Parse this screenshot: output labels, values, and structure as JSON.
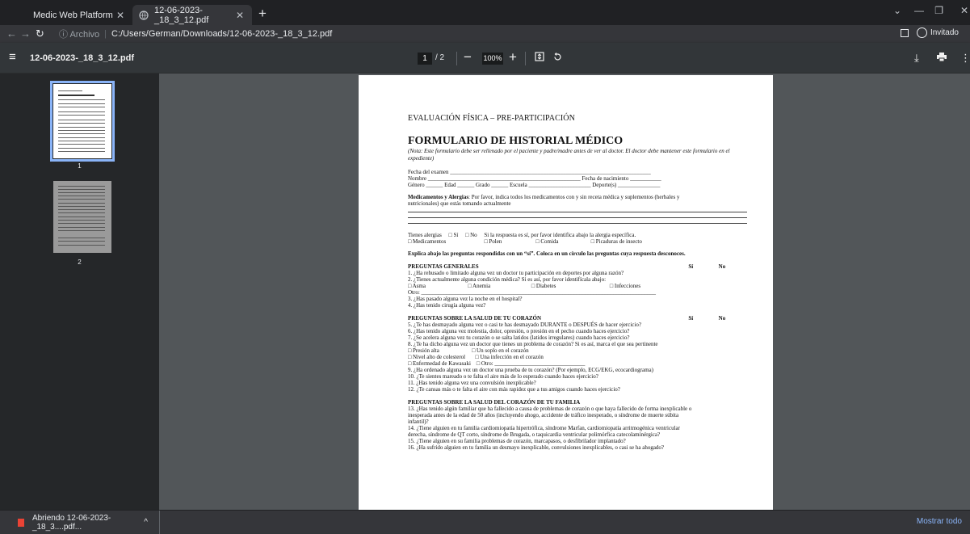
{
  "browser": {
    "tabs": [
      {
        "title": "Medic Web Platform",
        "close": "✕"
      },
      {
        "title": "12-06-2023-_18_3_12.pdf",
        "close": "✕"
      }
    ],
    "new_tab": "+",
    "address": {
      "info": "ⓘ Archivo",
      "url": "C:/Users/German/Downloads/12-06-2023-_18_3_12.pdf"
    },
    "profile": "Invitado"
  },
  "pdf_toolbar": {
    "filename": "12-06-2023-_18_3_12.pdf",
    "current_page": "1",
    "total_pages": "/ 2",
    "zoom": "100%",
    "zoom_out": "−",
    "zoom_in": "+"
  },
  "thumbnails": [
    {
      "label": "1",
      "selected": true
    },
    {
      "label": "2",
      "selected": false
    }
  ],
  "document": {
    "pre_title": "EVALUACIÓN FÍSICA – PRE-PARTICIPACIÓN",
    "title": "FORMULARIO DE HISTORIAL MÉDICO",
    "note": "(Nota: Este formulario debe ser rellenado por el paciente y padre/madre antes de ver al doctor. El doctor debe mantener este formulario en el expediente)",
    "fields": [
      "Fecha del examen _______________________________________________________________________",
      "Nombre ______________________________________________________ Fecha de nacimiento ___________",
      "Género ______ Edad ______ Grado ______ Escuela ______________________ Deporte(s) _______________"
    ],
    "meds_label": "Medicamentos y Alergias",
    "meds_text": ": Por favor, indica todos los medicamentos con y sin receta médica y suplementos (herbales y",
    "meds_text2": "nutricionales) que estás tomando actualmente",
    "allergies_line1": "Tienes alergias     □ Sí     □ No     Si la respuesta es sí, por favor identifica abajo la alergia específica.",
    "allergies_line2": "□ Medicamentos                           □ Polen                        □ Comida                       □ Picaduras de insecto",
    "explain": "Explica abajo las preguntas respondidas con un “sí”. Coloca en un círculo las preguntas cuya respuesta desconoces.",
    "yes": "Sí",
    "no": "No",
    "general_header": "PREGUNTAS GENERALES",
    "general": [
      "1. ¿Ha rehusado o limitado alguna vez un doctor tu participación en deportes por alguna razón?",
      "2. ¿Tienes actualmente alguna condición médica? Si es así, por favor identifícala abajo:",
      "□ Asma                              □ Anemia                             □ Diabetes                                      □ Infecciones",
      "Otro: ___________________________________________________________________________________",
      "3. ¿Has pasado alguna vez la noche en el hospital?",
      "4. ¿Has tenido cirugía alguna vez?"
    ],
    "heart_header": "PREGUNTAS SOBRE LA SALUD DE TU CORAZÓN",
    "heart": [
      "5. ¿Te has desmayado alguna vez o casi te has desmayado DURANTE o DESPUÉS de hacer ejercicio?",
      "6. ¿Has tenido alguna vez molestia, dolor, opresión, o presión en el pecho cuando haces ejercicio?",
      "7. ¿Se acelera alguna vez tu corazón o se salta latidos (latidos irregulares) cuando haces ejercicio?",
      "8. ¿Te ha dicho alguna vez un doctor que tienes un problema de corazón? Si es así, marca el que sea pertinente",
      "□ Presión alta                       □ Un soplo en el corazón",
      "□ Nivel alto de colesterol       □ Una infección en el corazón",
      "□ Enfermedad de Kawasaki    □ Otro: ________________________________",
      "9. ¿Ha ordenado alguna vez un doctor una prueba de tu corazón? (Por ejemplo, ECG/EKG, ecocardiograma)",
      "10. ¿Te sientes mareado o te falta el aire más de lo esperado cuando haces ejercicio?",
      "11. ¿Has tenido alguna vez una convulsión inexplicable?",
      "12. ¿Te cansas más o te falta el aire con más rapidez que a tus amigos cuando haces ejercicio?"
    ],
    "family_header": "PREGUNTAS SOBRE LA SALUD DEL CORAZÓN DE TU FAMILIA",
    "family": [
      "13. ¿Has tenido algún familiar que ha fallecido a causa de problemas de corazón o que haya fallecido de forma inexplicable o",
      "inesperada antes de la edad de 50 años (incluyendo ahogo, accidente de tráfico inesperado, o síndrome de muerte súbita",
      "infantil)?",
      "14. ¿Tiene alguien en tu familia cardiomiopatía hipertrófica, síndrome Marfan, cardiomiopatía arritmogénica ventricular",
      "derecha, síndrome de QT corto, síndrome de Brugada, o taquicardia ventricular polimórfica catecolaminérgica?",
      "15. ¿Tiene alguien en su familia problemas de corazón, marcapasos, o desfibrilador implantado?",
      "16. ¿Ha sufrido alguien en tu familia un desmayo inexplicable, convulsiones inexplicables, o casi se ha ahogado?"
    ]
  },
  "download": {
    "item": "Abriendo 12-06-2023-_18_3....pdf...",
    "show_all": "Mostrar todo"
  }
}
